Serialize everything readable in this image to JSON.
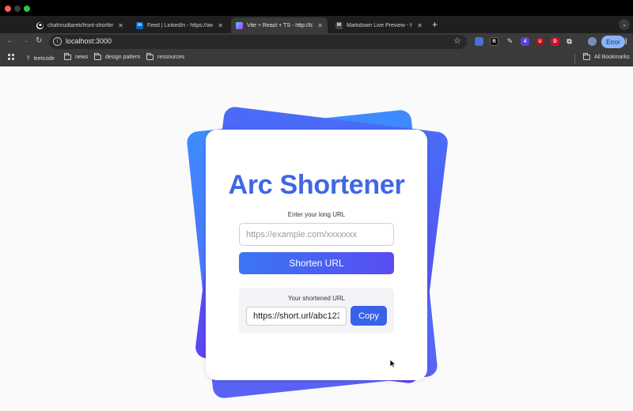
{
  "browser": {
    "tabs": [
      {
        "title": "chafroudtarek/front-shortlink",
        "icon": "github-icon",
        "active": false
      },
      {
        "title": "Feed | LinkedIn - https://www.li",
        "icon": "linkedin-icon",
        "active": false
      },
      {
        "title": "Vite + React + TS - http://local",
        "icon": "vite-icon",
        "active": true
      },
      {
        "title": "Markdown Live Preview - https",
        "icon": "markdown-icon",
        "active": false
      }
    ],
    "new_tab_symbol": "+",
    "url": "localhost:3000",
    "profile_button_label": "Error",
    "ext_labels": [
      "R",
      "4",
      "U",
      "D"
    ],
    "bookmarks": [
      {
        "label": "leetcode",
        "icon": "pin-icon"
      },
      {
        "label": "news",
        "icon": "folder-icon"
      },
      {
        "label": "design pattern",
        "icon": "folder-icon"
      },
      {
        "label": "ressources",
        "icon": "folder-icon"
      }
    ],
    "all_bookmarks_label": "All Bookmarks"
  },
  "app": {
    "title": "Arc Shortener",
    "input_label": "Enter your long URL",
    "input_placeholder": "https://example.com/xxxxxxx",
    "input_value": "",
    "shorten_button_label": "Shorten URL",
    "result_label": "Your shortened URL",
    "result_value": "https://short.url/abc123",
    "copy_button_label": "Copy"
  },
  "colors": {
    "title": "#3f67e6",
    "button_gradient_start": "#3a76f4",
    "button_gradient_end": "#5a4cf0",
    "copy_button": "#3a62e8"
  }
}
